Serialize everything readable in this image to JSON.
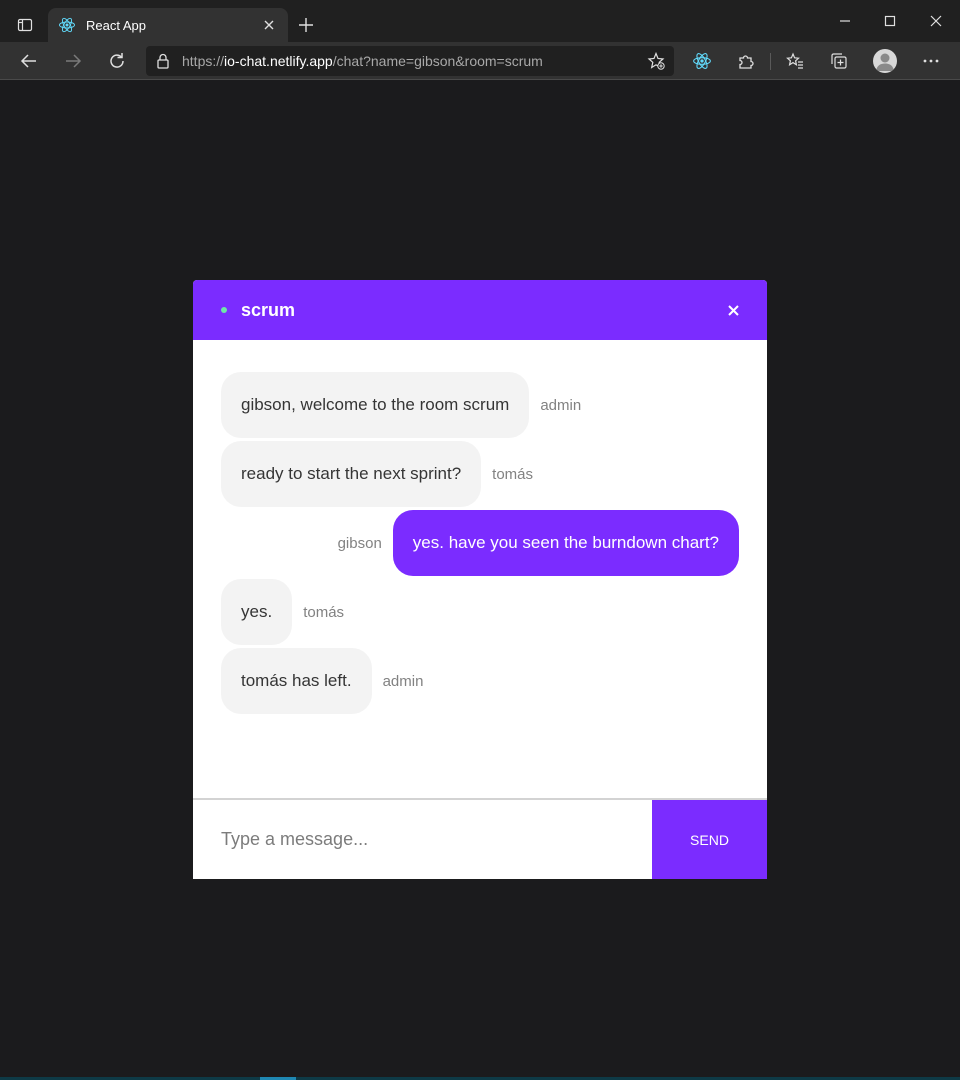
{
  "browser": {
    "tab_title": "React App",
    "url_scheme": "https://",
    "url_host": "io-chat.netlify.app",
    "url_path": "/chat?name=gibson&room=scrum",
    "icons": {
      "tab_actions": "tab-actions-icon",
      "favicon": "react-icon",
      "tab_close": "close-icon",
      "new_tab": "plus-icon",
      "back": "back-arrow-icon",
      "forward": "forward-arrow-icon",
      "refresh": "refresh-icon",
      "lock": "lock-icon",
      "add_favorite": "star-add-icon",
      "react_devtools": "react-icon",
      "extensions": "puzzle-icon",
      "favorites": "favorites-icon",
      "collections": "collections-icon",
      "profile": "avatar-icon",
      "menu": "more-icon"
    }
  },
  "chat": {
    "room": "scrum",
    "accent_color": "#7b2cff",
    "messages": [
      {
        "text": "gibson, welcome to the room scrum",
        "sender": "admin"
      },
      {
        "text": "ready to start the next sprint?",
        "sender": "tomás"
      },
      {
        "text": "yes. have you seen the burndown chart?",
        "sender": "gibson"
      },
      {
        "text": "yes.",
        "sender": "tomás"
      },
      {
        "text": "tomás has left.",
        "sender": "admin"
      }
    ],
    "composer": {
      "placeholder": "Type a message...",
      "send_label": "SEND"
    }
  }
}
